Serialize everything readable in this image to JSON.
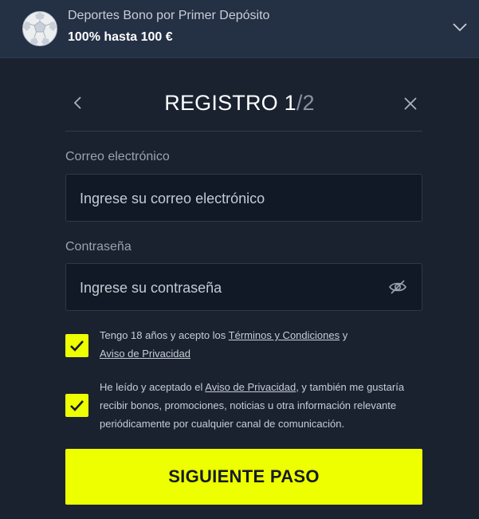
{
  "banner": {
    "title": "Deportes Bono por Primer Depósito",
    "subtitle": "100% hasta 100 €",
    "icon": "soccer-ball-icon",
    "toggle_icon": "chevron-down-icon"
  },
  "form": {
    "title_main": "REGISTRO",
    "step_current": "1",
    "step_total": "/2",
    "back_icon": "chevron-left-icon",
    "close_icon": "close-icon"
  },
  "email": {
    "label": "Correo electrónico",
    "placeholder": "Ingrese su correo electrónico",
    "value": ""
  },
  "password": {
    "label": "Contraseña",
    "placeholder": "Ingrese su contraseña",
    "value": "",
    "toggle_icon": "eye-off-icon"
  },
  "consent_age": {
    "checked": true,
    "text_before": "Tengo 18 años y acepto los ",
    "terms_link": "Términos y Condiciones",
    "text_middle": " y ",
    "privacy_link": "Aviso de Privacidad"
  },
  "consent_marketing": {
    "checked": true,
    "text_before": "He leído y aceptado el ",
    "privacy_link": "Aviso de Privacidad",
    "text_after": ", y también me gustaría recibir bonos, promociones, noticias u otra información relevante periódicamente por cualquier canal de comunicación."
  },
  "cta": {
    "label": "SIGUIENTE PASO"
  },
  "colors": {
    "accent": "#eeff00",
    "background": "#1a2230",
    "banner": "#243044",
    "input_bg": "#111926"
  }
}
